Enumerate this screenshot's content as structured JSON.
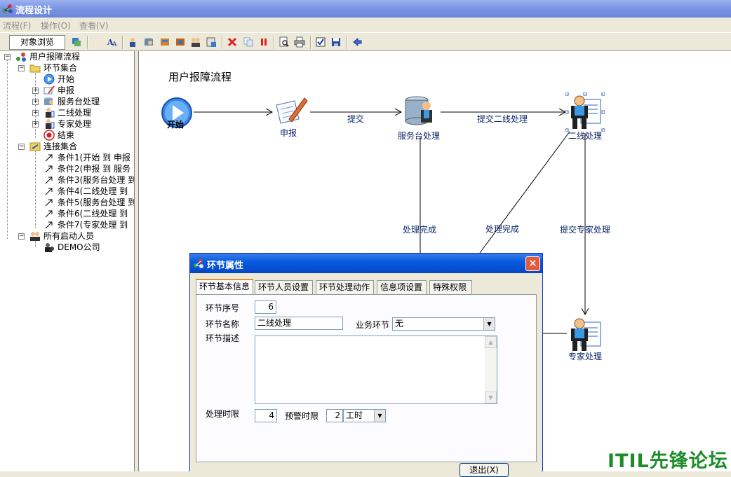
{
  "window": {
    "title": "流程设计"
  },
  "menu": {
    "items": [
      "流程(F)",
      "操作(O)",
      "查看(V)"
    ]
  },
  "toolbar": {
    "tab_label": "对象浏览",
    "buttons": [
      "organize-icon",
      "font-icon",
      "node-icon-1",
      "node-icon-2",
      "node-icon-3",
      "node-icon-4",
      "node-icon-5",
      "node-icon-6",
      "delete-icon",
      "copy-icon",
      "pause-icon",
      "preview-icon",
      "print-icon",
      "check-icon",
      "save-icon",
      "exit-icon"
    ]
  },
  "tree": {
    "root": "用户报障流程",
    "nodes_group": "环节集合",
    "nodes": [
      "开始",
      "申报",
      "服务台处理",
      "二线处理",
      "专家处理",
      "结束"
    ],
    "links_group": "连接集合",
    "links": [
      "条件1(开始 到 申报",
      "条件2(申报 到 服务",
      "条件3(服务台处理 到",
      "条件4(二线处理 到",
      "条件5(服务台处理 到",
      "条件6(二线处理 到",
      "条件7(专家处理 到"
    ],
    "people_group": "所有启动人员",
    "people": [
      "DEMO公司"
    ]
  },
  "diagram": {
    "title": "用户报障流程",
    "nodes": {
      "start": "开始",
      "report": "申报",
      "service": "服务台处理",
      "second": "二线处理",
      "expert": "专家处理"
    },
    "edges": {
      "submit": "提交",
      "submit_second": "提交二线处理",
      "done1": "处理完成",
      "done2": "处理完成",
      "submit_expert": "提交专家处理"
    }
  },
  "dialog": {
    "title": "环节属性",
    "close": "×",
    "tabs": [
      "环节基本信息",
      "环节人员设置",
      "环节处理动作",
      "信息项设置",
      "特殊权限"
    ],
    "fields": {
      "seq_label": "环节序号",
      "seq_value": "6",
      "name_label": "环节名称",
      "name_value": "二线处理",
      "biz_label": "业务环节",
      "biz_value": "无",
      "desc_label": "环节描述",
      "limit_label": "处理时限",
      "limit_value": "4",
      "warn_label": "预警时限",
      "warn_value": "2",
      "unit_value": "工时"
    },
    "exit_button": "退出(X)"
  },
  "watermark": "ITIL先锋论坛",
  "colors": {
    "accent": "#0446c6",
    "link_text": "#0a246a",
    "watermark": "#1e8c2a"
  }
}
